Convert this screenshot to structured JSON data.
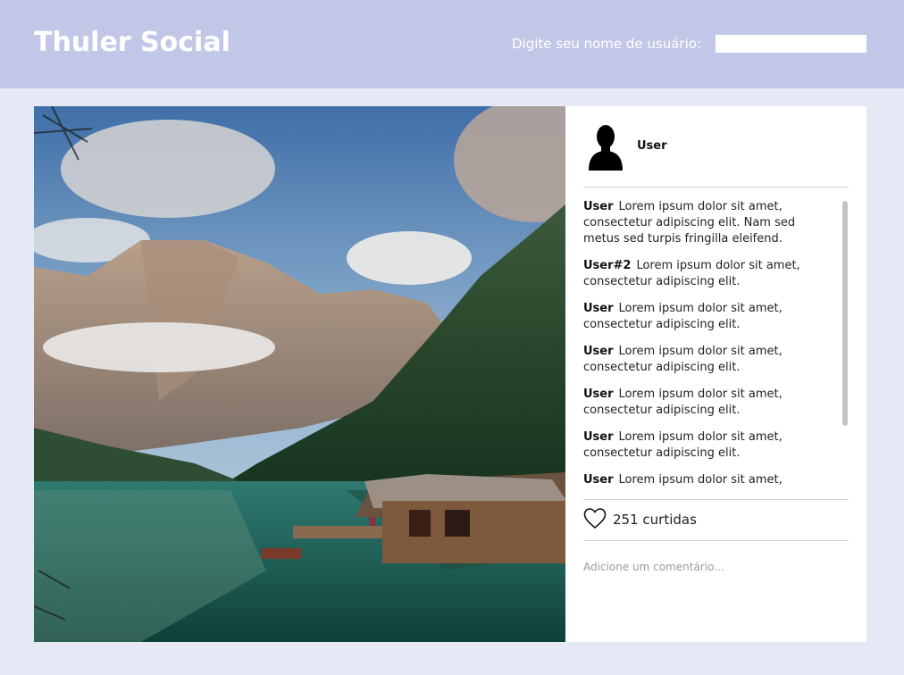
{
  "header": {
    "brand": "Thuler Social",
    "username_prompt": "Digite seu nome de usuário:",
    "username_value": "",
    "username_placeholder": ""
  },
  "post": {
    "image_alt": "Lake with wooden boathouse and mountains",
    "author": "User",
    "likes_label": "251 curtidas",
    "comment_placeholder": "Adicione um comentário...",
    "comments": [
      {
        "author": "User",
        "text": "Lorem ipsum dolor sit amet, consectetur adipiscing elit. Nam sed metus sed turpis fringilla eleifend."
      },
      {
        "author": "User#2",
        "text": "Lorem ipsum dolor sit amet, consectetur adipiscing elit."
      },
      {
        "author": "User",
        "text": "Lorem ipsum dolor sit amet, consectetur adipiscing elit."
      },
      {
        "author": "User",
        "text": "Lorem ipsum dolor sit amet, consectetur adipiscing elit."
      },
      {
        "author": "User",
        "text": "Lorem ipsum dolor sit amet, consectetur adipiscing elit."
      },
      {
        "author": "User",
        "text": "Lorem ipsum dolor sit amet, consectetur adipiscing elit."
      },
      {
        "author": "User",
        "text": "Lorem ipsum dolor sit amet,"
      }
    ]
  },
  "icons": {
    "avatar": "user-silhouette-icon",
    "like": "heart-icon"
  },
  "colors": {
    "header_bg": "#c3c7e7",
    "page_bg": "#e6e8f5",
    "panel_bg": "#ffffff"
  }
}
